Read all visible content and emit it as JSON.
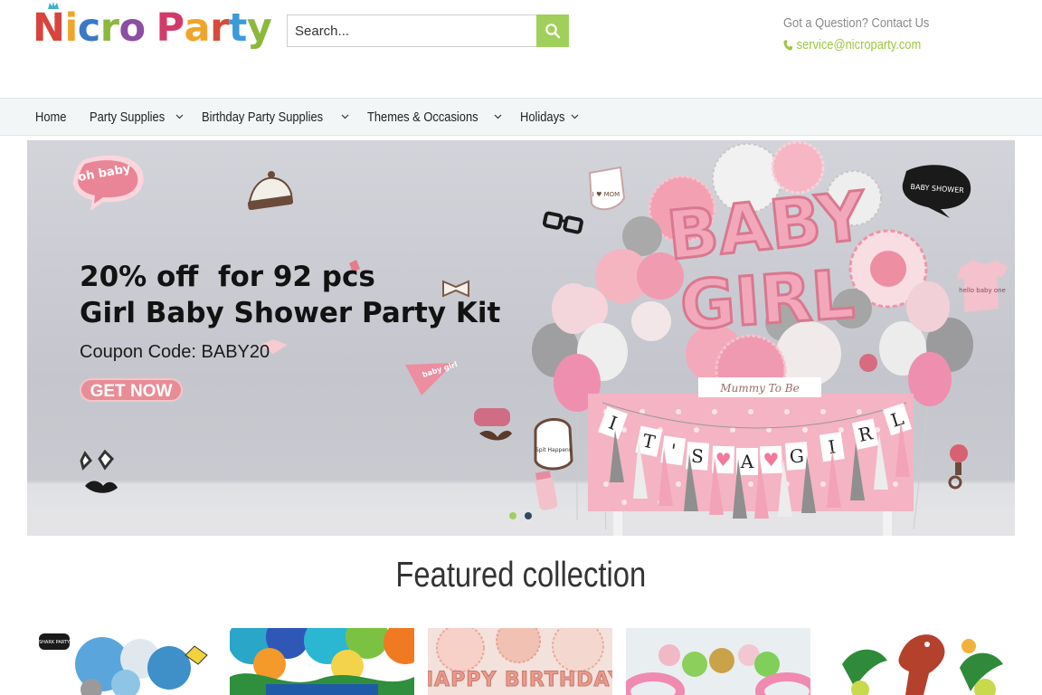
{
  "header": {
    "logo_parts": [
      "N",
      "i",
      "c",
      "r",
      "o",
      " ",
      "P",
      "a",
      "r",
      "t",
      "y"
    ],
    "logo_colors": [
      "#d7453e",
      "#f0a52a",
      "#3b78c6",
      "#8cb83c",
      "#8b4ea3",
      "",
      "#d13b6a",
      "#f0a52a",
      "#d64b3c",
      "#3b9bd8",
      "#8cb83c"
    ],
    "search_placeholder": "Search...",
    "contact_question": "Got a Question? Contact Us",
    "contact_email": "service@nicroparty.com"
  },
  "nav": {
    "items": [
      {
        "label": "Home",
        "has_dropdown": false
      },
      {
        "label": "Party Supplies",
        "has_dropdown": true
      },
      {
        "label": "Birthday Party Supplies",
        "has_dropdown": true
      },
      {
        "label": "Themes & Occasions",
        "has_dropdown": true
      },
      {
        "label": "Holidays",
        "has_dropdown": true
      }
    ]
  },
  "hero": {
    "headline_1": "20% off  for 92 pcs",
    "headline_2": "Girl Baby Shower Party Kit",
    "coupon": "Coupon Code: BABY20",
    "cta": "GET NOW",
    "sticker_oh_baby": "oh baby",
    "sticker_baby_shower": "BABY SHOWER",
    "balloon_text_1": "BABY",
    "balloon_text_2": "GIRL",
    "banner_letters": [
      "I",
      "T",
      "'",
      "S",
      "A",
      "G",
      "I",
      "R",
      "L"
    ],
    "table_sign": "Mummy To Be",
    "bib_text": "I ♥ MOM",
    "bib2_text": "Spit Happens",
    "onesie_text": "hello baby one",
    "pennant_text": "baby girl",
    "slider_dots": [
      "active",
      "inactive"
    ],
    "colors": {
      "dot_active": "#a1cf5b",
      "dot_inactive": "#2f4a5c"
    }
  },
  "featured": {
    "title": "Featured collection",
    "card_icons": [
      "shark-party-lanterns",
      "jungle-lanterns",
      "rose-gold-birthday",
      "pineapple-lanterns",
      "dinosaur-party"
    ],
    "card_label_1": "SHARK PARTY",
    "card_label_3": "HAPPY BIRTHDAY"
  },
  "colors": {
    "accent_green": "#a1cf5b",
    "link_green": "#9cc63e"
  }
}
